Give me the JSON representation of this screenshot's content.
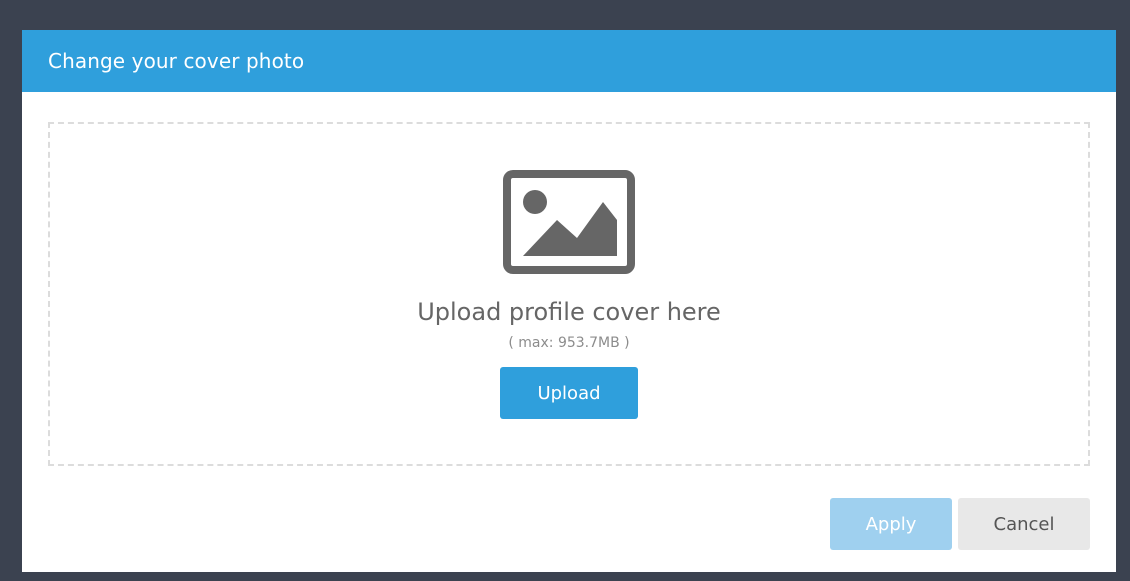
{
  "modal": {
    "title": "Change your cover photo"
  },
  "dropzone": {
    "icon": "image-icon",
    "title": "Upload profile cover here",
    "limit": "( max: 953.7MB )",
    "upload_label": "Upload"
  },
  "footer": {
    "apply_label": "Apply",
    "cancel_label": "Cancel"
  },
  "colors": {
    "backdrop": "#3b4250",
    "accent": "#2f9fdc",
    "apply_disabled": "#9fd0ef",
    "cancel_bg": "#e8e8e8",
    "icon": "#666666"
  }
}
